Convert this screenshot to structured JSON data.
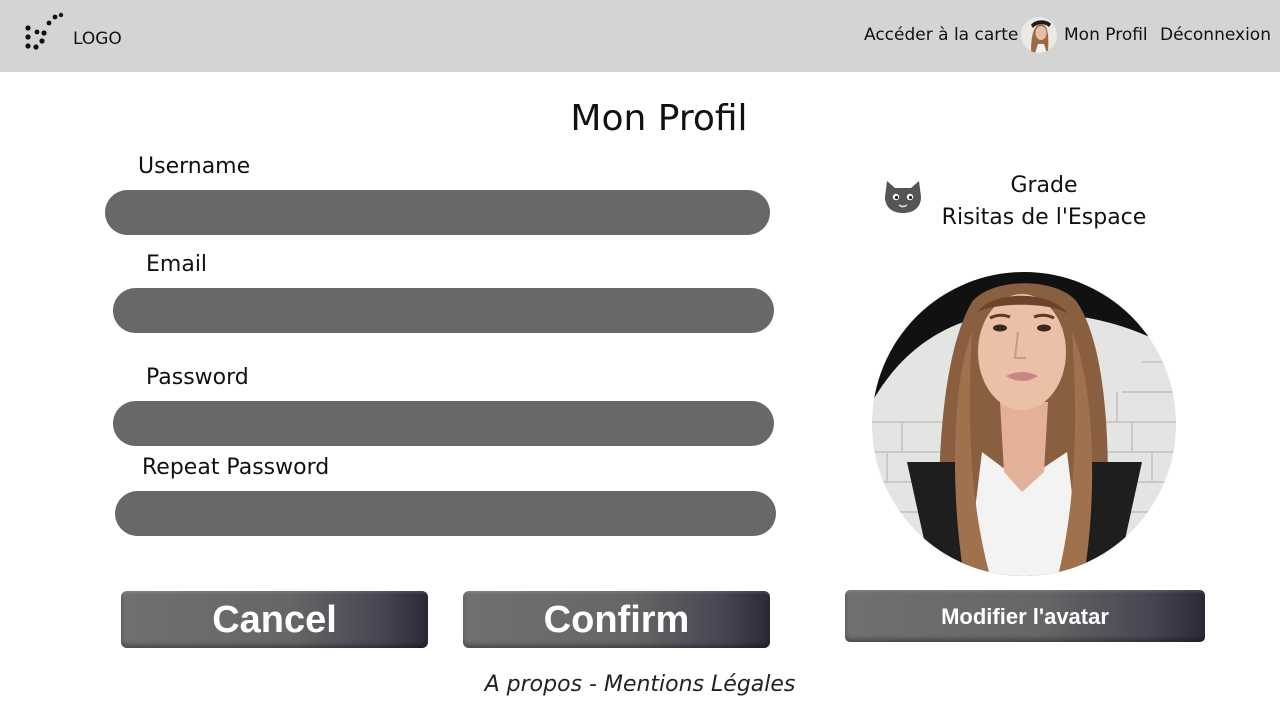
{
  "header": {
    "logo_text": "LOGO",
    "nav": {
      "carte": "Accéder à la carte",
      "profil": "Mon Profil",
      "logout": "Déconnexion"
    }
  },
  "page": {
    "title": "Mon Profil"
  },
  "form": {
    "username_label": "Username",
    "email_label": "Email",
    "password_label": "Password",
    "repeat_password_label": "Repeat Password",
    "username_value": "",
    "email_value": "",
    "password_value": "",
    "repeat_password_value": "",
    "cancel_label": "Cancel",
    "confirm_label": "Confirm"
  },
  "profile": {
    "grade_label": "Grade",
    "grade_value": "Risitas de l'Espace",
    "grade_icon": "cat-face-icon",
    "modify_avatar_label": "Modifier l'avatar"
  },
  "footer": {
    "about": "A propos",
    "separator": " - ",
    "legal": "Mentions Légales"
  },
  "colors": {
    "topbar_bg": "#d4d4d4",
    "input_bg": "#686868",
    "button_bg": "#666666",
    "button_shade": "#2b2a38"
  }
}
